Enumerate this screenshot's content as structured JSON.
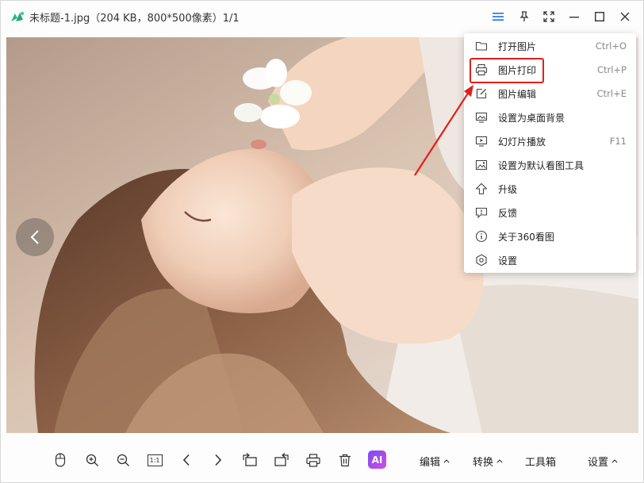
{
  "window": {
    "title": "未标题-1.jpg（204 KB，800*500像素）1/1"
  },
  "colors": {
    "accent": "#1f6fe0",
    "highlight_red": "#e0201b",
    "logo_green": "#2fb58a"
  },
  "titlebar_icons": [
    "menu-icon",
    "pin-icon",
    "fullscreen-icon",
    "minimize-icon",
    "maximize-icon",
    "close-icon"
  ],
  "menu": {
    "items": [
      {
        "label": "打开图片",
        "shortcut": "Ctrl+O",
        "icon": "folder-icon"
      },
      {
        "label": "图片打印",
        "shortcut": "Ctrl+P",
        "icon": "printer-icon"
      },
      {
        "label": "图片编辑",
        "shortcut": "Ctrl+E",
        "icon": "edit-icon"
      },
      {
        "label": "设置为桌面背景",
        "shortcut": "",
        "icon": "desktop-image-icon"
      },
      {
        "label": "幻灯片播放",
        "shortcut": "F11",
        "icon": "slideshow-icon"
      },
      {
        "label": "设置为默认看图工具",
        "shortcut": "",
        "icon": "image-icon"
      },
      {
        "label": "升级",
        "shortcut": "",
        "icon": "upgrade-arrow-icon"
      },
      {
        "label": "反馈",
        "shortcut": "",
        "icon": "feedback-icon"
      },
      {
        "label": "关于360看图",
        "shortcut": "",
        "icon": "info-icon"
      },
      {
        "label": "设置",
        "shortcut": "",
        "icon": "settings-hex-icon"
      }
    ]
  },
  "toolbar": {
    "icons": [
      "mouse-icon",
      "zoom-in-icon",
      "zoom-out-icon",
      "actual-size-icon",
      "previous-icon",
      "next-icon",
      "rotate-left-icon",
      "rotate-right-icon",
      "print-icon",
      "delete-icon"
    ],
    "actual_size_label": "1:1",
    "ai_label": "AI",
    "edit_label": "编辑",
    "convert_label": "转换",
    "toolbox_label": "工具箱",
    "settings_label": "设置"
  }
}
